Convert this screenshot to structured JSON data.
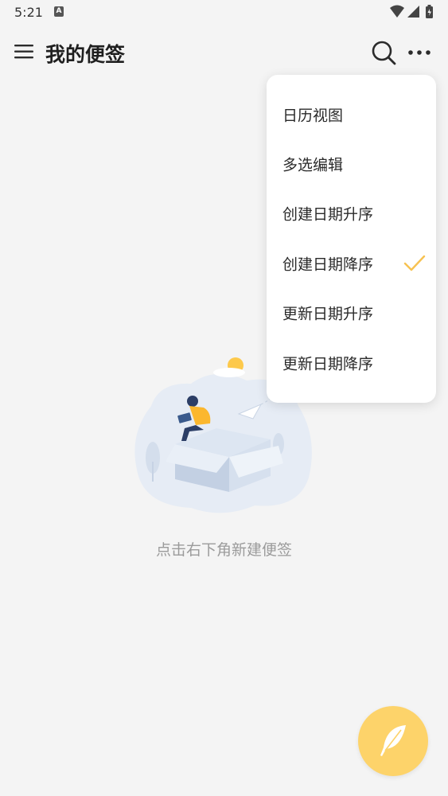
{
  "status_bar": {
    "time": "5:21",
    "app_icon_letter": "A",
    "icons": [
      "wifi-icon",
      "signal-icon",
      "battery-icon"
    ]
  },
  "app_bar": {
    "title": "我的便签",
    "menu_icon": "hamburger-menu-icon",
    "search_icon": "search-icon",
    "more_icon": "more-horizontal-icon"
  },
  "dropdown": {
    "items": [
      {
        "label": "日历视图",
        "checked": false
      },
      {
        "label": "多选编辑",
        "checked": false
      },
      {
        "label": "创建日期升序",
        "checked": false
      },
      {
        "label": "创建日期降序",
        "checked": true
      },
      {
        "label": "更新日期升序",
        "checked": false
      },
      {
        "label": "更新日期降序",
        "checked": false
      }
    ]
  },
  "empty_state": {
    "hint": "点击右下角新建便签",
    "illustration": "empty-box-illustration"
  },
  "fab": {
    "icon": "feather-pen-icon"
  },
  "colors": {
    "background": "#f4f4f4",
    "accent": "#fdd36a",
    "check": "#f7c251",
    "hint_text": "#9b9b9b"
  }
}
